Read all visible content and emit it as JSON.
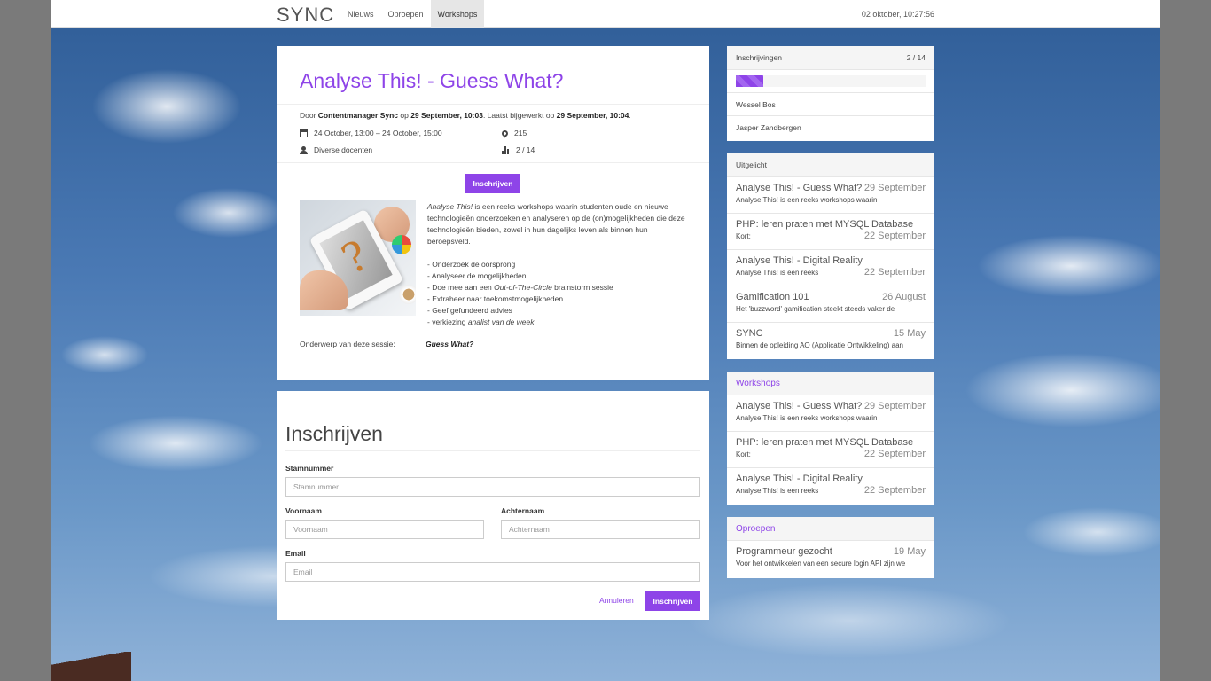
{
  "nav": {
    "brand": "SYNC",
    "items": [
      "Nieuws",
      "Oproepen",
      "Workshops"
    ],
    "active": "Workshops",
    "clock": "02 oktober, 10:27:56"
  },
  "article": {
    "title": "Analyse This! - Guess What?",
    "meta": {
      "prefix": "Door ",
      "author": "Contentmanager Sync",
      "on": " op ",
      "created": "29 September, 10:03",
      "updated_prefix": ". Laatst bijgewerkt op ",
      "updated": "29 September, 10:04",
      "suffix": "."
    },
    "date_range": "24 October, 13:00 – 24 October, 15:00",
    "location": "215",
    "teachers": "Diverse docenten",
    "capacity": "2 / 14",
    "register_button": "Inschrijven",
    "intro_em": "Analyse This!",
    "intro": " is een reeks workshops waarin studenten oude en nieuwe technologieën onderzoeken en analyseren op de (on)mogelijkheden die deze technologieën bieden, zowel in hun dagelijks leven als binnen hun beroepsveld.",
    "bullets": {
      "b1": "- Onderzoek de oorsprong",
      "b2": "- Analyseer de mogelijkheden",
      "b3_pre": "- Doe mee aan een ",
      "b3_em": "Out-of-The-Circle",
      "b3_post": " brainstorm sessie",
      "b4": "- Extraheer naar toekomstmogelijkheden",
      "b5": "- Geef gefundeerd advies",
      "b6_pre": "- verkiezing ",
      "b6_em": "analist van de week"
    },
    "subject_label": "Onderwerp van deze sessie:",
    "subject_value": "Guess What?"
  },
  "form": {
    "title": "Inschrijven",
    "stamnummer_label": "Stamnummer",
    "stamnummer_placeholder": "Stamnummer",
    "voornaam_label": "Voornaam",
    "voornaam_placeholder": "Voornaam",
    "achternaam_label": "Achternaam",
    "achternaam_placeholder": "Achternaam",
    "email_label": "Email",
    "email_placeholder": "Email",
    "cancel": "Annuleren",
    "submit": "Inschrijven"
  },
  "sidebar": {
    "inschrijvingen": {
      "title": "Inschrijvingen",
      "count": "2 / 14",
      "progress": 0.143,
      "names": [
        "Wessel Bos",
        "Jasper Zandbergen"
      ]
    },
    "uitgelicht": {
      "title": "Uitgelicht",
      "items": [
        {
          "title": "Analyse This! - Guess What?",
          "date": "29 September",
          "sub": "Analyse This! is een reeks workshops waarin"
        },
        {
          "title": "PHP: leren praten met MYSQL Database",
          "date": "22 September",
          "sub": "Kort:"
        },
        {
          "title": "Analyse This! - Digital Reality",
          "date": "22 September",
          "sub": "Analyse This! is een reeks"
        },
        {
          "title": "Gamification 101",
          "date": "26 August",
          "sub": "Het 'buzzword' gamification steekt steeds vaker de"
        },
        {
          "title": "SYNC",
          "date": "15 May",
          "sub": "Binnen de opleiding AO (Applicatie Ontwikkeling) aan"
        }
      ]
    },
    "workshops": {
      "title": "Workshops",
      "items": [
        {
          "title": "Analyse This! - Guess What?",
          "date": "29 September",
          "sub": "Analyse This! is een reeks workshops waarin"
        },
        {
          "title": "PHP: leren praten met MYSQL Database",
          "date": "22 September",
          "sub": "Kort:"
        },
        {
          "title": "Analyse This! - Digital Reality",
          "date": "22 September",
          "sub": "Analyse This! is een reeks"
        }
      ]
    },
    "oproepen": {
      "title": "Oproepen",
      "items": [
        {
          "title": "Programmeur gezocht",
          "date": "19 May",
          "sub": "Voor het ontwikkelen van een secure login API zijn we"
        }
      ]
    }
  },
  "colors": {
    "accent": "#8e44e8"
  }
}
